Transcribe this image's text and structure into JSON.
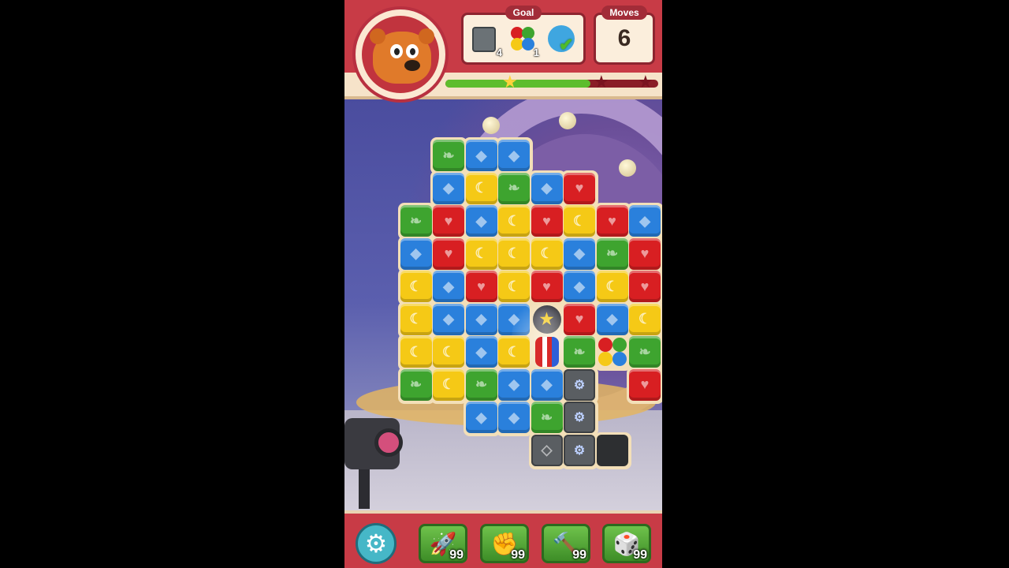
{
  "header": {
    "goal_title": "Goal",
    "moves_title": "Moves",
    "moves_value": "6",
    "goals": [
      {
        "icon": "stone-block-icon",
        "count": "4"
      },
      {
        "icon": "balloon-icon",
        "count": "1"
      },
      {
        "icon": "bird-icon",
        "status": "completed"
      }
    ],
    "progress": {
      "fraction": 0.68,
      "stars_earned": 1,
      "stars_total": 3
    }
  },
  "board": {
    "rows": [
      [
        "",
        "",
        "green",
        "blue",
        "blue",
        "",
        "",
        "",
        ""
      ],
      [
        "",
        "",
        "blue",
        "yellow",
        "green",
        "blue",
        "red",
        "",
        ""
      ],
      [
        "",
        "green",
        "red",
        "blue",
        "yellow",
        "red",
        "yellow",
        "red",
        "blue"
      ],
      [
        "",
        "blue",
        "red",
        "yellow",
        "yellow",
        "yellow",
        "blue",
        "green",
        "red"
      ],
      [
        "",
        "yellow",
        "blue",
        "red",
        "yellow",
        "red",
        "blue",
        "yellow",
        "red"
      ],
      [
        "",
        "yellow",
        "blue",
        "blue",
        "blue",
        "bomb",
        "red",
        "blue",
        "yellow"
      ],
      [
        "",
        "yellow",
        "yellow",
        "blue",
        "yellow",
        "rocket",
        "green",
        "pinwheel",
        "green"
      ],
      [
        "",
        "green",
        "yellow",
        "green",
        "blue",
        "blue",
        "cage",
        "",
        "red"
      ],
      [
        "",
        "",
        "",
        "blue",
        "blue",
        "green",
        "cage",
        "",
        ""
      ],
      [
        "",
        "",
        "",
        "",
        "",
        "stone",
        "cage",
        "dark",
        ""
      ]
    ]
  },
  "toolbar": {
    "settings_icon": "gear-icon",
    "boosters": [
      {
        "icon": "rocket-booster-icon",
        "count": "99"
      },
      {
        "icon": "boxing-glove-icon",
        "count": "99"
      },
      {
        "icon": "hammer-icon",
        "count": "99"
      },
      {
        "icon": "dice-icon",
        "count": "99"
      }
    ]
  },
  "colors": {
    "header_red": "#c83b46",
    "green_block": "#3ea42f",
    "blue_block": "#2a80dc",
    "red_block": "#d81f22",
    "yellow_block": "#f5c916"
  }
}
